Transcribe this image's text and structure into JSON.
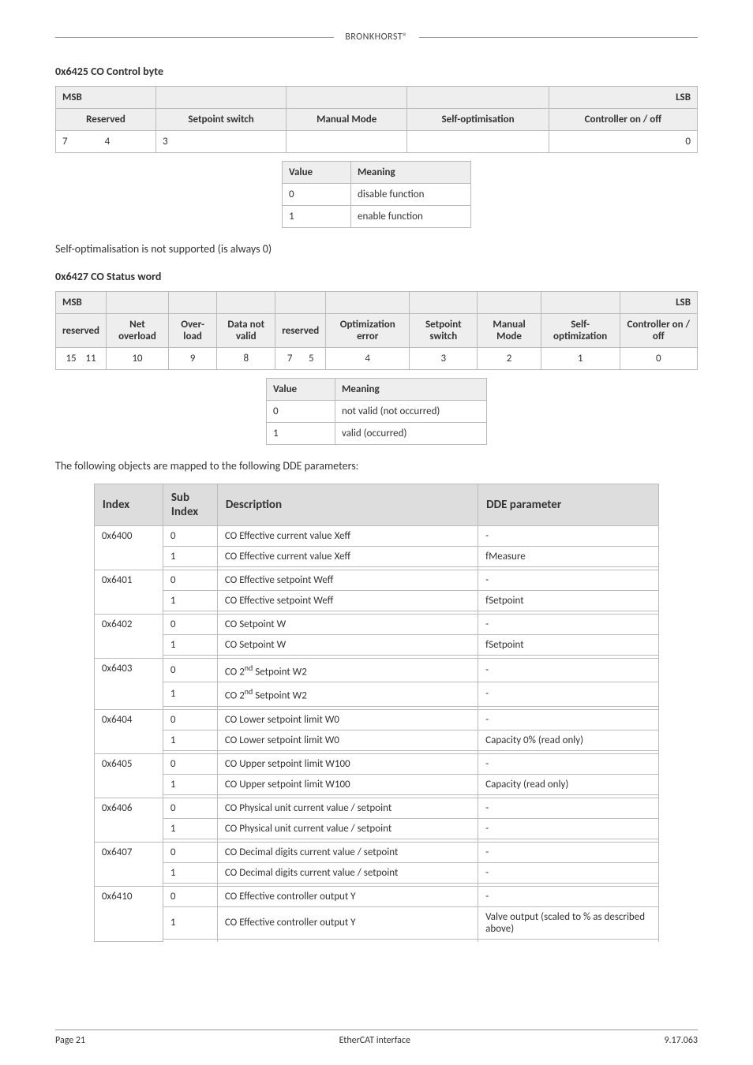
{
  "brand": "BRONKHORST®",
  "sec1": {
    "title": "0x6425 CO Control byte",
    "msb": "MSB",
    "lsb": "LSB",
    "headers": [
      "Reserved",
      "Setpoint switch",
      "Manual Mode",
      "Self-optimisation",
      "Controller on / off"
    ],
    "row": [
      "7                4",
      "3",
      "",
      "",
      "0"
    ],
    "vm": {
      "h1": "Value",
      "h2": "Meaning",
      "rows": [
        [
          "0",
          "disable function"
        ],
        [
          "1",
          "enable function"
        ]
      ]
    }
  },
  "selfopt": "Self-optimalisation is not supported (is always 0)",
  "sec2": {
    "title": "0x6427 CO Status word",
    "msb": "MSB",
    "lsb": "LSB",
    "headers": [
      "reserved",
      "Net overload",
      "Over-load",
      "Data not valid",
      "reserved",
      "Optimization error",
      "Setpoint switch",
      "Manual Mode",
      "Self-optimization",
      "Controller on / off"
    ],
    "row": [
      "15    11",
      "10",
      "9",
      "8",
      "7       5",
      "4",
      "3",
      "2",
      "1",
      "0"
    ],
    "vm": {
      "h1": "Value",
      "h2": "Meaning",
      "rows": [
        [
          "0",
          "not valid (not occurred)"
        ],
        [
          "1",
          "valid (occurred)"
        ]
      ]
    }
  },
  "mappara": "The following objects are mapped to the following DDE parameters:",
  "mainHeaders": [
    "Index",
    "Sub Index",
    "Description",
    "DDE parameter"
  ],
  "groups": [
    {
      "idx": "0x6400",
      "rows": [
        {
          "sub": "0",
          "desc": "CO Effective current value Xeff",
          "dde": "-"
        },
        {
          "sub": "1",
          "desc": "CO Effective current value Xeff",
          "dde": "fMeasure"
        }
      ]
    },
    {
      "idx": "0x6401",
      "rows": [
        {
          "sub": "0",
          "desc": "CO Effective setpoint Weff",
          "dde": "-"
        },
        {
          "sub": "1",
          "desc": "CO Effective setpoint Weff",
          "dde": "fSetpoint"
        }
      ]
    },
    {
      "idx": "0x6402",
      "rows": [
        {
          "sub": "0",
          "desc": "CO Setpoint W",
          "dde": "-"
        },
        {
          "sub": "1",
          "desc": "CO Setpoint W",
          "dde": "fSetpoint"
        }
      ]
    },
    {
      "idx": "0x6403",
      "rows": [
        {
          "sub": "0",
          "desc": "CO 2nd Setpoint W2",
          "dde": "-"
        },
        {
          "sub": "1",
          "desc": "CO 2nd Setpoint W2",
          "dde": "-"
        }
      ]
    },
    {
      "idx": "0x6404",
      "rows": [
        {
          "sub": "0",
          "desc": "CO Lower setpoint limit W0",
          "dde": "-"
        },
        {
          "sub": "1",
          "desc": "CO Lower setpoint limit W0",
          "dde": "Capacity 0% (read only)"
        }
      ]
    },
    {
      "idx": "0x6405",
      "rows": [
        {
          "sub": "0",
          "desc": "CO Upper setpoint limit W100",
          "dde": "-"
        },
        {
          "sub": "1",
          "desc": "CO Upper setpoint limit W100",
          "dde": "Capacity (read only)"
        }
      ]
    },
    {
      "idx": "0x6406",
      "rows": [
        {
          "sub": "0",
          "desc": "CO Physical unit current value / setpoint",
          "dde": "-"
        },
        {
          "sub": "1",
          "desc": "CO Physical unit current value / setpoint",
          "dde": "-"
        }
      ]
    },
    {
      "idx": "0x6407",
      "rows": [
        {
          "sub": "0",
          "desc": "CO Decimal digits current value / setpoint",
          "dde": "-"
        },
        {
          "sub": "1",
          "desc": "CO Decimal digits current value / setpoint",
          "dde": "-"
        }
      ]
    },
    {
      "idx": "0x6410",
      "rows": [
        {
          "sub": "0",
          "desc": "CO Effective controller output Y",
          "dde": "-"
        },
        {
          "sub": "1",
          "desc": "CO Effective controller output Y",
          "dde": "Valve output (scaled to % as described above)"
        }
      ]
    }
  ],
  "footer": {
    "left": "Page 21",
    "center": "EtherCAT interface",
    "right": "9.17.063"
  }
}
